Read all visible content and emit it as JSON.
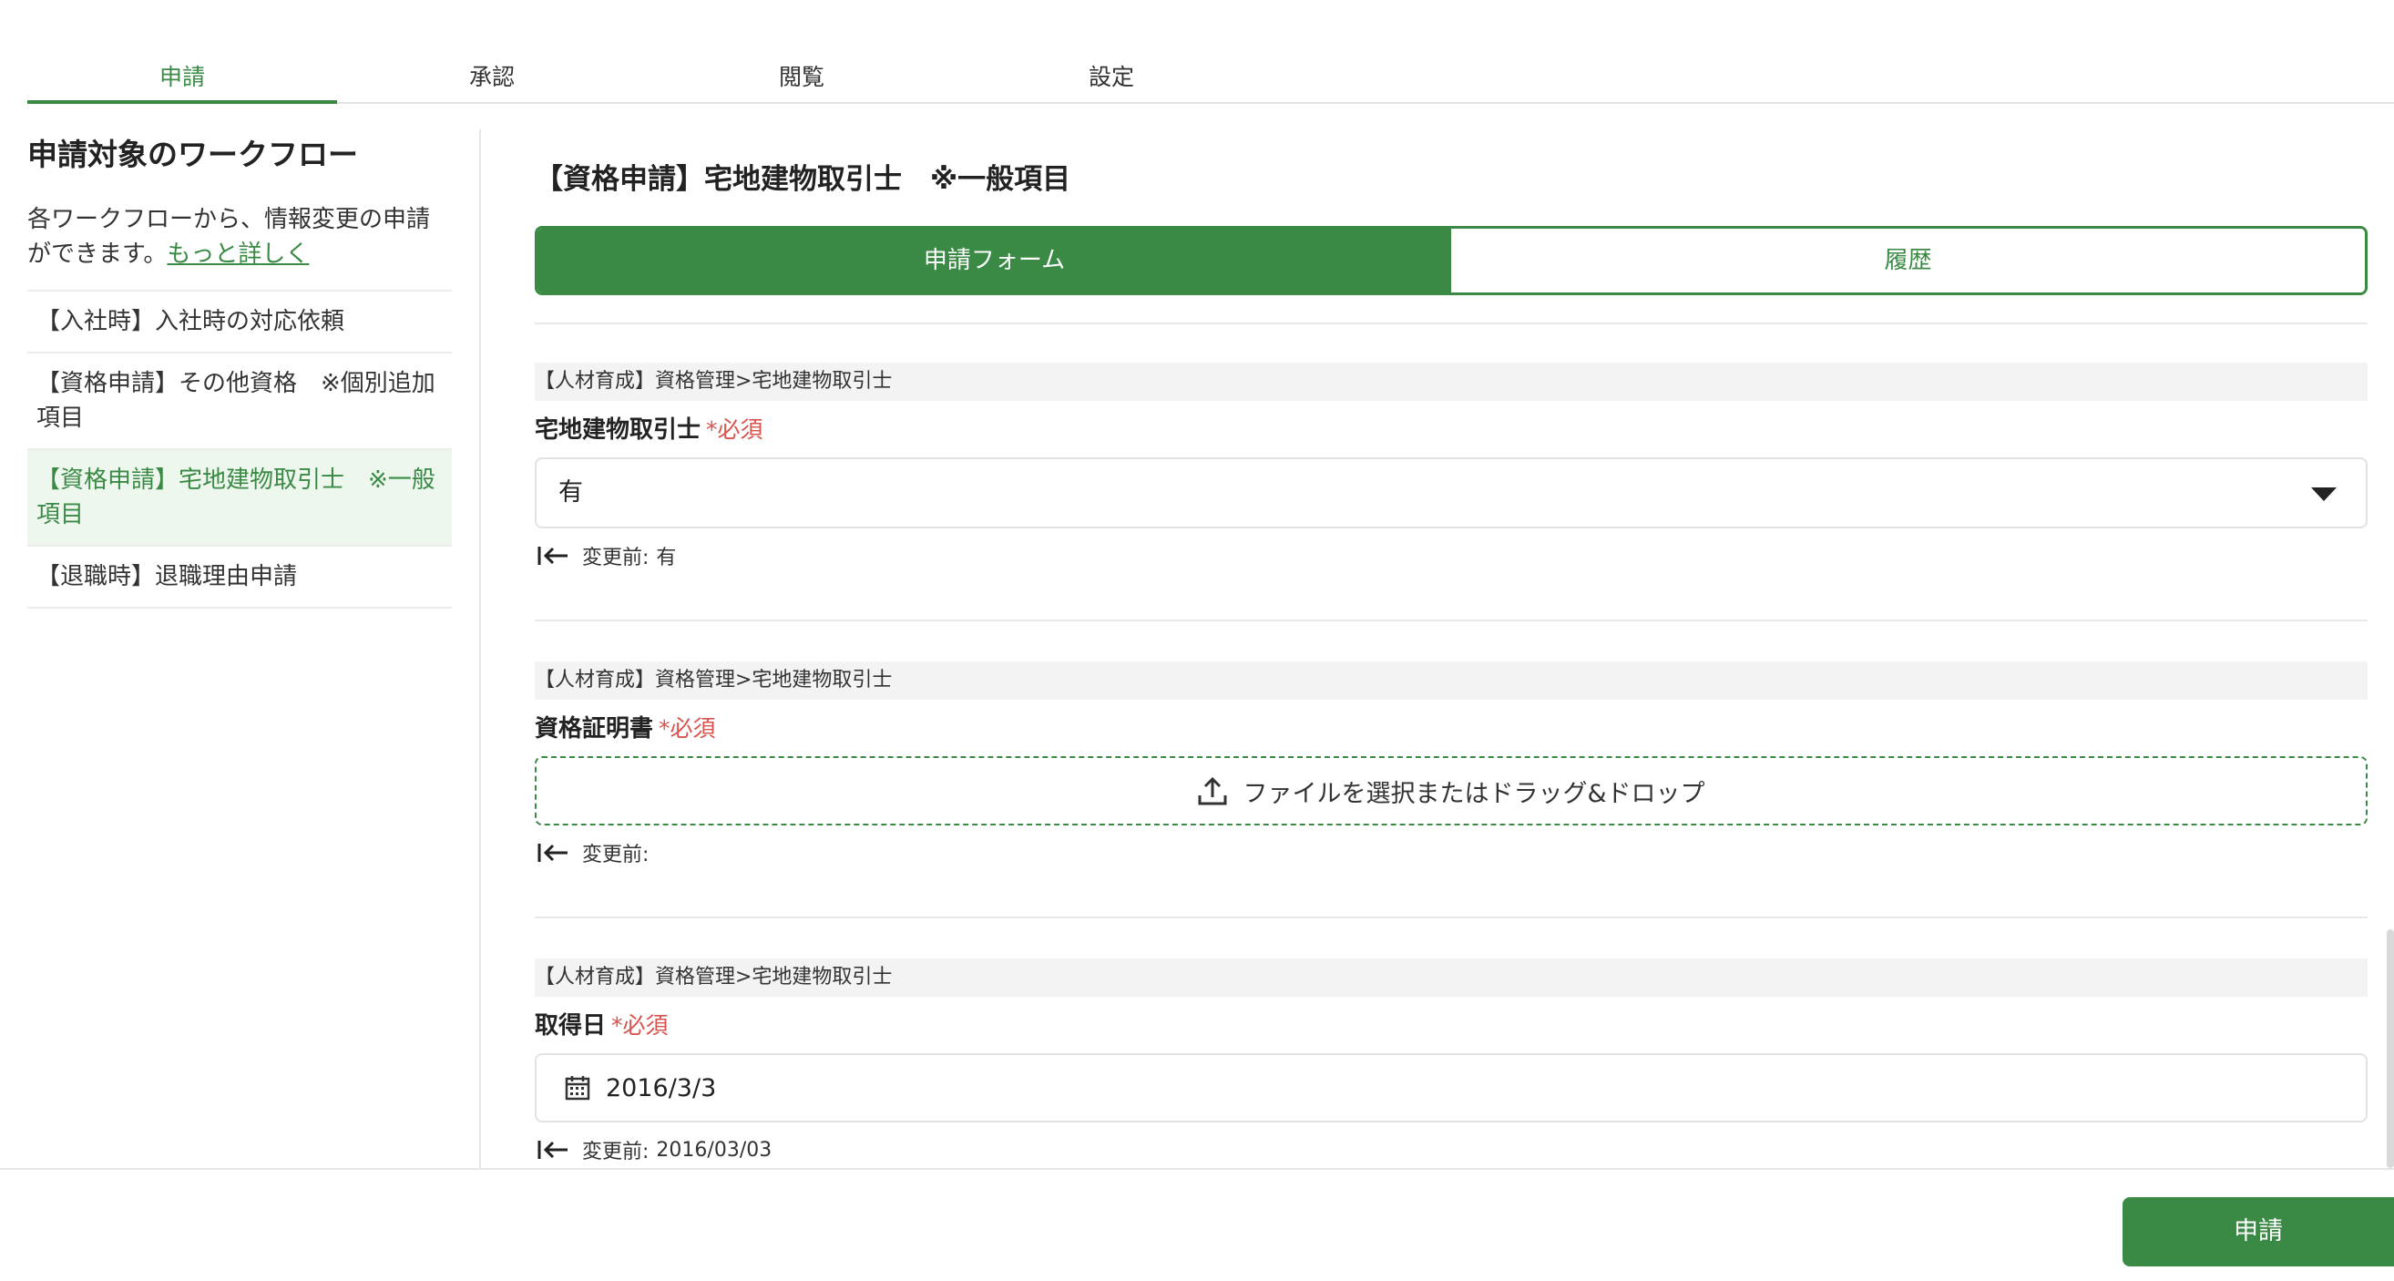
{
  "top_tabs": [
    {
      "label": "申請",
      "active": true
    },
    {
      "label": "承認",
      "active": false
    },
    {
      "label": "閲覧",
      "active": false
    },
    {
      "label": "設定",
      "active": false
    }
  ],
  "sidebar": {
    "title": "申請対象のワークフロー",
    "description": "各ワークフローから、情報変更の申請ができます。",
    "more_link": "もっと詳しく",
    "items": [
      {
        "label": "【入社時】入社時の対応依頼",
        "active": false
      },
      {
        "label": "【資格申請】その他資格　※個別追加項目",
        "active": false
      },
      {
        "label": "【資格申請】宅地建物取引士　※一般項目",
        "active": true
      },
      {
        "label": "【退職時】退職理由申請",
        "active": false
      }
    ]
  },
  "main": {
    "title": "【資格申請】宅地建物取引士　※一般項目",
    "tabs": [
      {
        "label": "申請フォーム",
        "active": true
      },
      {
        "label": "履歴",
        "active": false
      }
    ],
    "fields": [
      {
        "breadcrumb": "【人材育成】資格管理>宅地建物取引士",
        "label": "宅地建物取引士",
        "required": "*必須",
        "type": "select",
        "value": "有",
        "prev_prefix": "変更前:",
        "prev_value": "有"
      },
      {
        "breadcrumb": "【人材育成】資格管理>宅地建物取引士",
        "label": "資格証明書",
        "required": "*必須",
        "type": "file",
        "dropzone_text": "ファイルを選択またはドラッグ&ドロップ",
        "prev_prefix": "変更前:",
        "prev_value": ""
      },
      {
        "breadcrumb": "【人材育成】資格管理>宅地建物取引士",
        "label": "取得日",
        "required": "*必須",
        "type": "date",
        "value": "2016/3/3",
        "prev_prefix": "変更前:",
        "prev_value": "2016/03/03"
      }
    ]
  },
  "footer": {
    "submit_label": "申請"
  },
  "colors": {
    "accent": "#3a8a45",
    "required": "#d9534f",
    "active_bg": "#eef7ee"
  }
}
